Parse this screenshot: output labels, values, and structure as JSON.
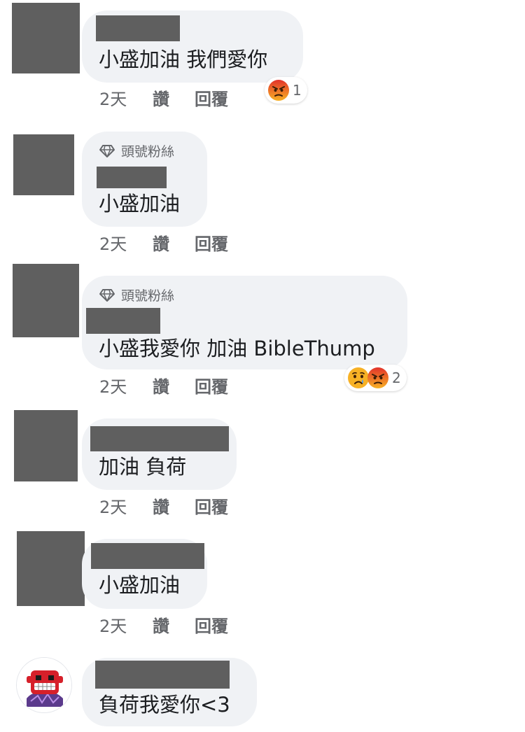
{
  "comments": [
    {
      "text": "小盛加油 我們愛你",
      "time": "2天",
      "like": "讚",
      "reply": "回覆",
      "reactions": {
        "icons": [
          "angry-emoji"
        ],
        "count": "1"
      }
    },
    {
      "badge": "頭號粉絲",
      "text": "小盛加油",
      "time": "2天",
      "like": "讚",
      "reply": "回覆"
    },
    {
      "badge": "頭號粉絲",
      "text": "小盛我愛你 加油 BibleThump",
      "time": "2天",
      "like": "讚",
      "reply": "回覆",
      "reactions": {
        "icons": [
          "sad-emoji",
          "angry-emoji"
        ],
        "count": "2"
      }
    },
    {
      "text": "加油 負荷",
      "time": "2天",
      "like": "讚",
      "reply": "回覆"
    },
    {
      "text": "小盛加油",
      "time": "2天",
      "like": "讚",
      "reply": "回覆"
    },
    {
      "text": "負荷我愛你<3"
    }
  ],
  "colors": {
    "bubble": "#f0f2f5",
    "redacted": "#5f5f5f",
    "meta_text": "#65676b",
    "angry": "#e9710f",
    "sad": "#f7b125"
  }
}
